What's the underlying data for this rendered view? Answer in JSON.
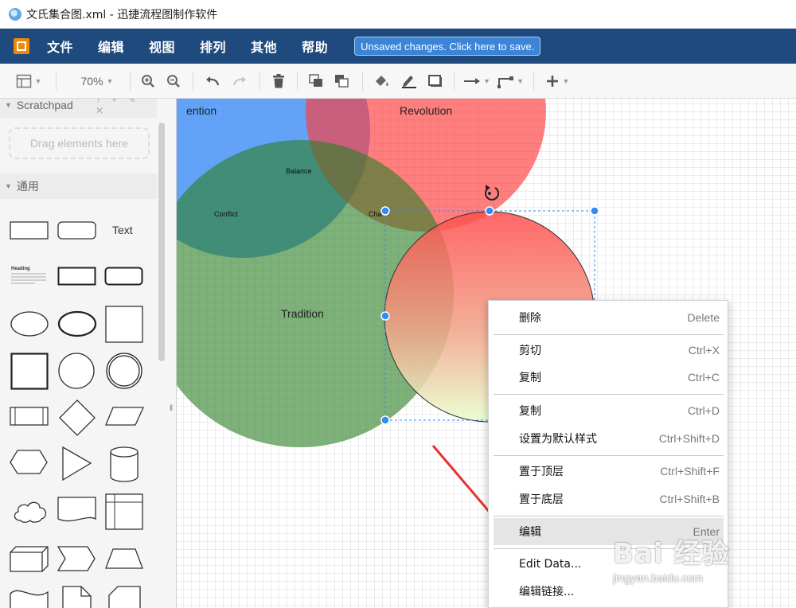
{
  "window": {
    "title": "文氏集合图.xml - 迅捷流程图制作软件"
  },
  "menubar": {
    "items": [
      "文件",
      "编辑",
      "视图",
      "排列",
      "其他",
      "帮助"
    ],
    "save_notice": "Unsaved changes. Click here to save."
  },
  "toolbar": {
    "zoom": "70%",
    "icons": [
      "format-panel-icon",
      "zoom-in-icon",
      "zoom-out-icon",
      "undo-icon",
      "redo-icon",
      "delete-icon",
      "to-front-icon",
      "to-back-icon",
      "fill-color-icon",
      "line-color-icon",
      "shadow-icon",
      "connection-icon",
      "waypoints-icon",
      "insert-icon"
    ]
  },
  "sidebar": {
    "scratchpad": {
      "title": "Scratchpad",
      "tools": "? + ✎ ✕",
      "drop_hint": "Drag elements here"
    },
    "general": {
      "title": "通用"
    },
    "shape_text": "Text",
    "heading_sample": "Heading"
  },
  "diagram": {
    "labels": {
      "invention": "ention",
      "revolution": "Revolution",
      "balance": "Balance",
      "conflict": "Conflict",
      "change": "Cha",
      "tradition": "Tradition"
    },
    "colors": {
      "blue": "#3f8ff6",
      "red": "#ff3b3b",
      "green": "#4e9a47",
      "selection": "#2f8cf7"
    }
  },
  "context_menu": {
    "items": [
      {
        "label": "删除",
        "shortcut": "Delete"
      },
      {
        "label": "剪切",
        "shortcut": "Ctrl+X"
      },
      {
        "label": "复制",
        "shortcut": "Ctrl+C"
      },
      {
        "label": "复制",
        "shortcut": "Ctrl+D"
      },
      {
        "label": "设置为默认样式",
        "shortcut": "Ctrl+Shift+D"
      },
      {
        "label": "置于顶层",
        "shortcut": "Ctrl+Shift+F"
      },
      {
        "label": "置于底层",
        "shortcut": "Ctrl+Shift+B"
      },
      {
        "label": "编辑",
        "shortcut": "Enter"
      },
      {
        "label": "Edit Data...",
        "shortcut": ""
      },
      {
        "label": "编辑链接...",
        "shortcut": ""
      }
    ]
  },
  "watermark": {
    "logo_text": "Bai 经验",
    "url": "jingyan.baidu.com"
  }
}
